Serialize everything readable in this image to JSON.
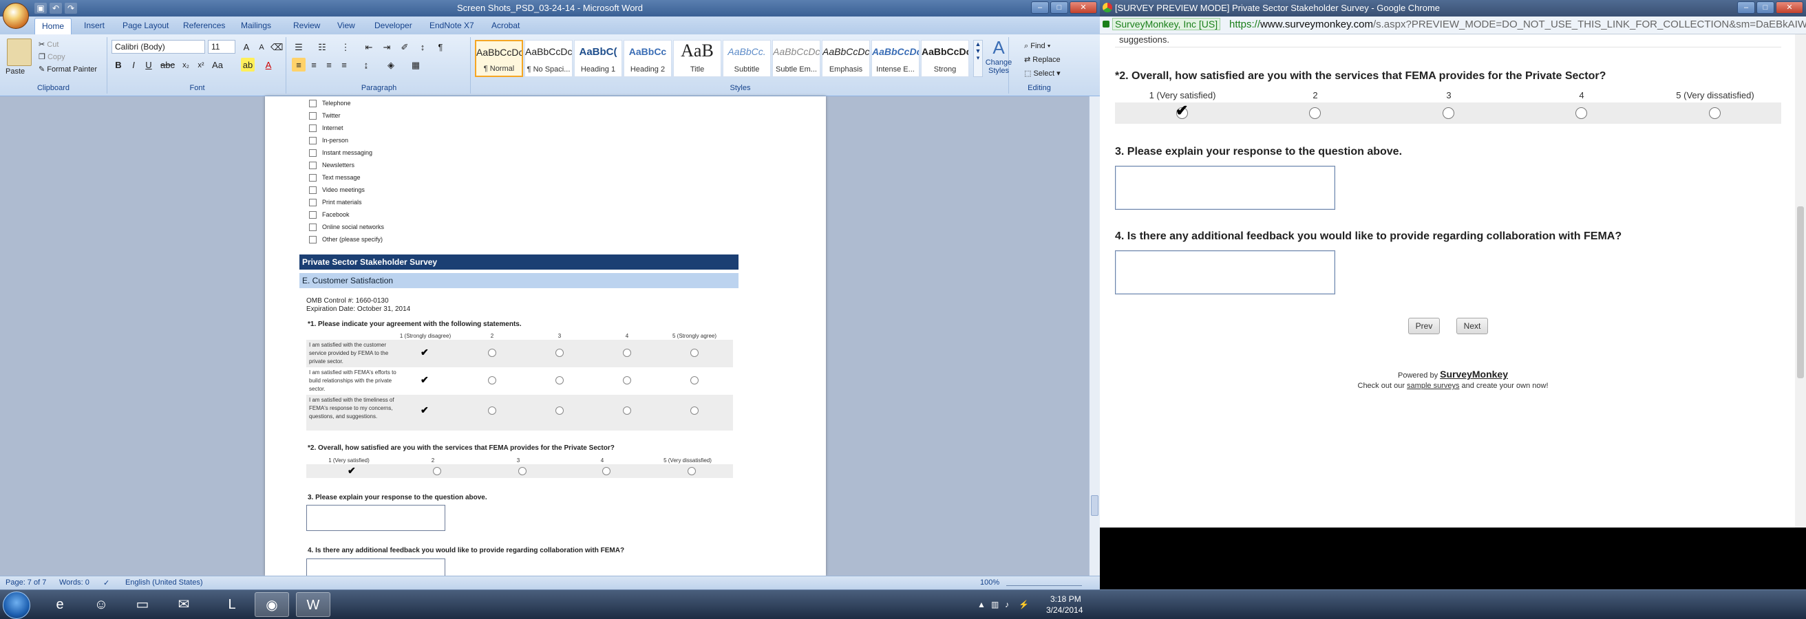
{
  "word": {
    "title": "Screen Shots_PSD_03-24-14 - Microsoft Word",
    "tabs": [
      "Home",
      "Insert",
      "Page Layout",
      "References",
      "Mailings",
      "Review",
      "View",
      "Developer",
      "EndNote X7",
      "Acrobat"
    ],
    "clipboard": {
      "paste": "Paste",
      "cut": "Cut",
      "copy": "Copy",
      "format_painter": "Format Painter",
      "label": "Clipboard"
    },
    "font": {
      "name": "Calibri (Body)",
      "size": "11",
      "label": "Font"
    },
    "paragraph_label": "Paragraph",
    "styles": [
      {
        "preview": "AaBbCcDc",
        "name": "¶ Normal"
      },
      {
        "preview": "AaBbCcDc",
        "name": "¶ No Spaci..."
      },
      {
        "preview": "AaBbC(",
        "name": "Heading 1"
      },
      {
        "preview": "AaBbCc",
        "name": "Heading 2"
      },
      {
        "preview": "AaB",
        "name": "Title"
      },
      {
        "preview": "AaBbCc.",
        "name": "Subtitle"
      },
      {
        "preview": "AaBbCcDc",
        "name": "Subtle Em..."
      },
      {
        "preview": "AaBbCcDc",
        "name": "Emphasis"
      },
      {
        "preview": "AaBbCcDc",
        "name": "Intense E..."
      },
      {
        "preview": "AaBbCcDc",
        "name": "Strong"
      }
    ],
    "styles_label": "Styles",
    "change_styles": "Change Styles",
    "editing": {
      "find": "Find",
      "replace": "Replace",
      "select": "Select",
      "label": "Editing"
    },
    "doc": {
      "checkbox_items": [
        "Telephone",
        "Twitter",
        "Internet",
        "In-person",
        "Instant messaging",
        "Newsletters",
        "Text message",
        "Video meetings",
        "Print materials",
        "Facebook",
        "Online social networks",
        "Other (please specify)"
      ],
      "survey_title": "Private Sector Stakeholder Survey",
      "section": "E. Customer Satisfaction",
      "omb": "OMB Control #: 1660-0130",
      "expiration": "Expiration Date: October 31, 2014",
      "q1": "*1. Please indicate your agreement with the following statements.",
      "q1_columns": [
        "1 (Strongly disagree)",
        "2",
        "3",
        "4",
        "5 (Strongly agree)"
      ],
      "q1_rows": [
        "I am satisfied with the customer service provided by FEMA to the private sector.",
        "I am satisfied with FEMA's efforts to build relationships with the private sector.",
        "I am satisfied with the timeliness of FEMA's response to my concerns, questions, and suggestions."
      ],
      "q2": "*2. Overall, how satisfied are you with the services that FEMA provides for the Private Sector?",
      "q2_columns": [
        "1 (Very satisfied)",
        "2",
        "3",
        "4",
        "5 (Very dissatisfied)"
      ],
      "q3": "3. Please explain your response to the question above.",
      "q4": "4. Is there any additional feedback you would like to provide regarding collaboration with FEMA?"
    },
    "status": {
      "page": "Page: 7 of 7",
      "words": "Words: 0",
      "language": "English (United States)",
      "zoom": "100%"
    }
  },
  "chrome": {
    "title": "[SURVEY PREVIEW MODE] Private Sector Stakeholder Survey - Google Chrome",
    "security": "SurveyMonkey, Inc [US]",
    "url_prefix": "https://",
    "url_host": "www.surveymonkey.com",
    "url_rest": "/s.aspx?PREVIEW_MODE=DO_NOT_USE_THIS_LINK_FOR_COLLECTION&sm=DaEBkAIW",
    "suggestions": "suggestions.",
    "q2": "*2. Overall, how satisfied are you with the services that FEMA provides for the Private Sector?",
    "q2_columns": [
      "1 (Very satisfied)",
      "2",
      "3",
      "4",
      "5 (Very dissatisfied)"
    ],
    "q3": "3. Please explain your response to the question above.",
    "q4": "4. Is there any additional feedback you would like to provide regarding collaboration with FEMA?",
    "prev": "Prev",
    "next": "Next",
    "powered_by": "Powered by",
    "brand": "SurveyMonkey",
    "checkout_pre": "Check out our",
    "checkout_link": "sample surveys",
    "checkout_post": "and create your own now!"
  },
  "taskbar": {
    "time": "3:18 PM",
    "date": "3/24/2014"
  }
}
